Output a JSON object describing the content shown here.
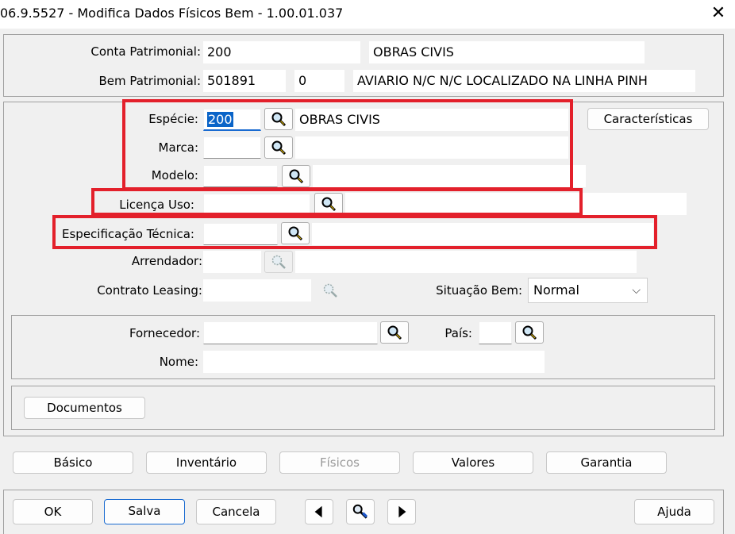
{
  "window": {
    "title": "06.9.5527 - Modifica Dados Físicos Bem - 1.00.01.037",
    "close_glyph": "✕"
  },
  "header": {
    "conta_label": "Conta Patrimonial:",
    "conta_code": "200",
    "conta_desc": "OBRAS CIVIS",
    "bem_label": "Bem Patrimonial:",
    "bem_code": "501891",
    "bem_seq": "0",
    "bem_desc": "AVIARIO N/C N/C LOCALIZADO NA LINHA PINH"
  },
  "form": {
    "especie_label": "Espécie:",
    "especie_value": "200",
    "especie_desc": "OBRAS CIVIS",
    "marca_label": "Marca:",
    "marca_value": "",
    "modelo_label": "Modelo:",
    "modelo_value": "",
    "licenca_label": "Licença Uso:",
    "licenca_value": "",
    "espec_label": "Especificação Técnica:",
    "espec_value": "",
    "arrendador_label": "Arrendador:",
    "arrendador_value": "",
    "contrato_label": "Contrato Leasing:",
    "contrato_value": "",
    "situacao_label": "Situação Bem:",
    "situacao_value": "Normal",
    "caracteristicas_label": "Características"
  },
  "fornecedor": {
    "fornecedor_label": "Fornecedor:",
    "fornecedor_value": "",
    "pais_label": "País:",
    "pais_value": "",
    "nome_label": "Nome:",
    "nome_value": ""
  },
  "documentos_label": "Documentos",
  "tabs": [
    {
      "label": "Básico",
      "enabled": true
    },
    {
      "label": "Inventário",
      "enabled": true
    },
    {
      "label": "Físicos",
      "enabled": false
    },
    {
      "label": "Valores",
      "enabled": true
    },
    {
      "label": "Garantia",
      "enabled": true
    }
  ],
  "footer": {
    "ok": "OK",
    "salva": "Salva",
    "cancela": "Cancela",
    "ajuda": "Ajuda"
  },
  "icons": {
    "lookup": "magnifier-icon",
    "lookup_disabled": "magnifier-disabled-icon",
    "prev": "arrow-left-icon",
    "next": "arrow-right-icon",
    "zoom": "zoom-tool-icon"
  },
  "colors": {
    "highlight_box": "#e3202b",
    "selection": "#0a64c8",
    "focus_border": "#1a6bd1"
  }
}
